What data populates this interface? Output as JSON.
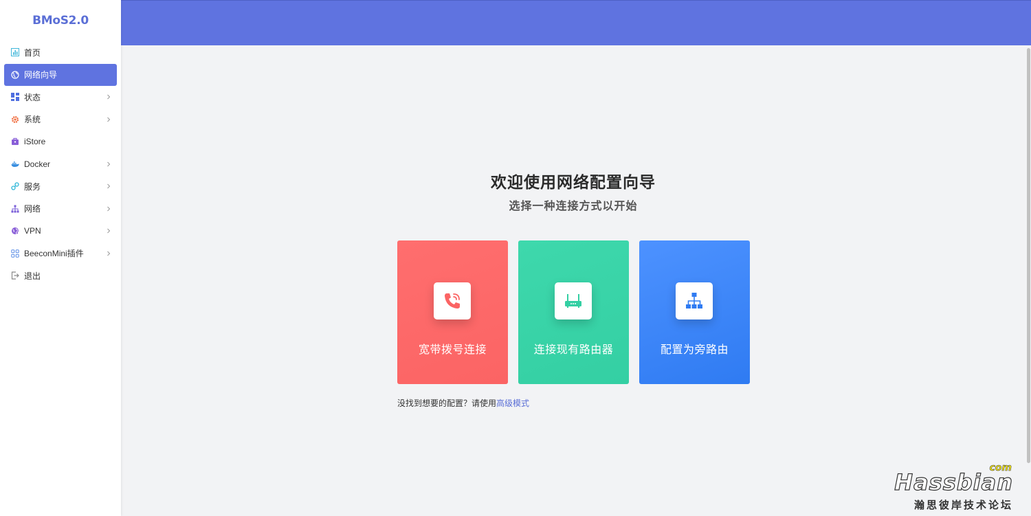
{
  "app": {
    "logo": "BMoS2.0"
  },
  "sidebar": {
    "items": [
      {
        "label": "首页",
        "icon": "dashboard-icon",
        "color": "#3fb6d9",
        "has_submenu": false,
        "active": false
      },
      {
        "label": "网络向导",
        "icon": "globe-icon",
        "color": "#ffffff",
        "has_submenu": false,
        "active": true
      },
      {
        "label": "状态",
        "icon": "grid-icon",
        "color": "#4f6fe0",
        "has_submenu": true,
        "active": false
      },
      {
        "label": "系统",
        "icon": "gear-icon",
        "color": "#f06a3b",
        "has_submenu": true,
        "active": false
      },
      {
        "label": "iStore",
        "icon": "store-icon",
        "color": "#8a5fd8",
        "has_submenu": false,
        "active": false
      },
      {
        "label": "Docker",
        "icon": "docker-icon",
        "color": "#3a8fe0",
        "has_submenu": true,
        "active": false
      },
      {
        "label": "服务",
        "icon": "service-icon",
        "color": "#2fb7d8",
        "has_submenu": true,
        "active": false
      },
      {
        "label": "网络",
        "icon": "network-icon",
        "color": "#7b5fd8",
        "has_submenu": true,
        "active": false
      },
      {
        "label": "VPN",
        "icon": "vpn-icon",
        "color": "#8a5fd8",
        "has_submenu": true,
        "active": false
      },
      {
        "label": "BeeconMini插件",
        "icon": "plugin-icon",
        "color": "#5b8de6",
        "has_submenu": true,
        "active": false
      },
      {
        "label": "退出",
        "icon": "logout-icon",
        "color": "#888888",
        "has_submenu": false,
        "active": false
      }
    ]
  },
  "main": {
    "title": "欢迎使用网络配置向导",
    "subtitle": "选择一种连接方式以开始",
    "cards": [
      {
        "label": "宽带拨号连接",
        "icon": "phone-call-icon",
        "color": "#fb6464"
      },
      {
        "label": "连接现有路由器",
        "icon": "router-icon",
        "color": "#34cfa3"
      },
      {
        "label": "配置为旁路由",
        "icon": "sitemap-icon",
        "color": "#2f7bf2"
      }
    ],
    "hint_text": "没找到想要的配置？请使用",
    "hint_link": "高级模式"
  },
  "watermark": {
    "main": "Hassbian",
    "com": "com",
    "sub": "瀚思彼岸技术论坛"
  },
  "colors": {
    "accent": "#5f73e0",
    "background": "#f2f3f5"
  }
}
